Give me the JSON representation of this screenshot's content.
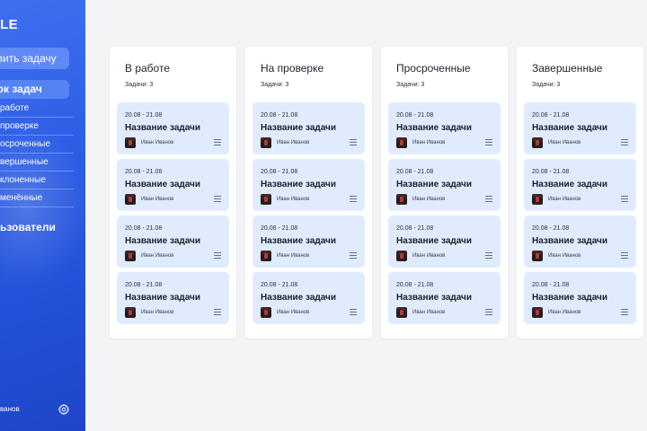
{
  "sidebar": {
    "logo": "LE",
    "add_task": "авить задачу",
    "list_header": "сок задач",
    "items": [
      {
        "label": "работе"
      },
      {
        "label": "проверке"
      },
      {
        "label": "осроченные"
      },
      {
        "label": "вершенные"
      },
      {
        "label": "клоненные"
      },
      {
        "label": "менённые"
      }
    ],
    "users": "ьзователи",
    "current_user": "ванов",
    "settings_icon": "gear-icon"
  },
  "board": {
    "columns": [
      {
        "title": "В работе",
        "count": "Задачи: 3",
        "cards": [
          {
            "date": "20.08 - 21.08",
            "title": "Название задачи",
            "assignee": "Иван Иванов"
          },
          {
            "date": "20.08 - 21.08",
            "title": "Название задачи",
            "assignee": "Иван Иванов"
          },
          {
            "date": "20.08 - 21.08",
            "title": "Название задачи",
            "assignee": "Иван Иванов"
          },
          {
            "date": "20.08 - 21.08",
            "title": "Название задачи",
            "assignee": "Иван Иванов"
          }
        ]
      },
      {
        "title": "На проверке",
        "count": "Задачи: 3",
        "cards": [
          {
            "date": "20.08 - 21.08",
            "title": "Название задачи",
            "assignee": "Иван Иванов"
          },
          {
            "date": "20.08 - 21.08",
            "title": "Название задачи",
            "assignee": "Иван Иванов"
          },
          {
            "date": "20.08 - 21.08",
            "title": "Название задачи",
            "assignee": "Иван Иванов"
          },
          {
            "date": "20.08 - 21.08",
            "title": "Название задачи",
            "assignee": "Иван Иванов"
          }
        ]
      },
      {
        "title": "Просроченные",
        "count": "Задачи: 3",
        "cards": [
          {
            "date": "20.08 - 21.08",
            "title": "Название задачи",
            "assignee": "Иван Иванов"
          },
          {
            "date": "20.08 - 21.08",
            "title": "Название задачи",
            "assignee": "Иван Иванов"
          },
          {
            "date": "20.08 - 21.08",
            "title": "Название задачи",
            "assignee": "Иван Иванов"
          },
          {
            "date": "20.08 - 21.08",
            "title": "Название задачи",
            "assignee": "Иван Иванов"
          }
        ]
      },
      {
        "title": "Завершенные",
        "count": "Задачи: 3",
        "cards": [
          {
            "date": "20.08 - 21.08",
            "title": "Название задачи",
            "assignee": "Иван Иванов"
          },
          {
            "date": "20.08 - 21.08",
            "title": "Название задачи",
            "assignee": "Иван Иванов"
          },
          {
            "date": "20.08 - 21.08",
            "title": "Название задачи",
            "assignee": "Иван Иванов"
          },
          {
            "date": "20.08 - 21.08",
            "title": "Название задачи",
            "assignee": "Иван Иванов"
          }
        ]
      }
    ]
  },
  "colors": {
    "sidebar_accent": "#2f5fe6",
    "card_background": "#e1ebfe",
    "page_background": "#f3f4f6"
  }
}
